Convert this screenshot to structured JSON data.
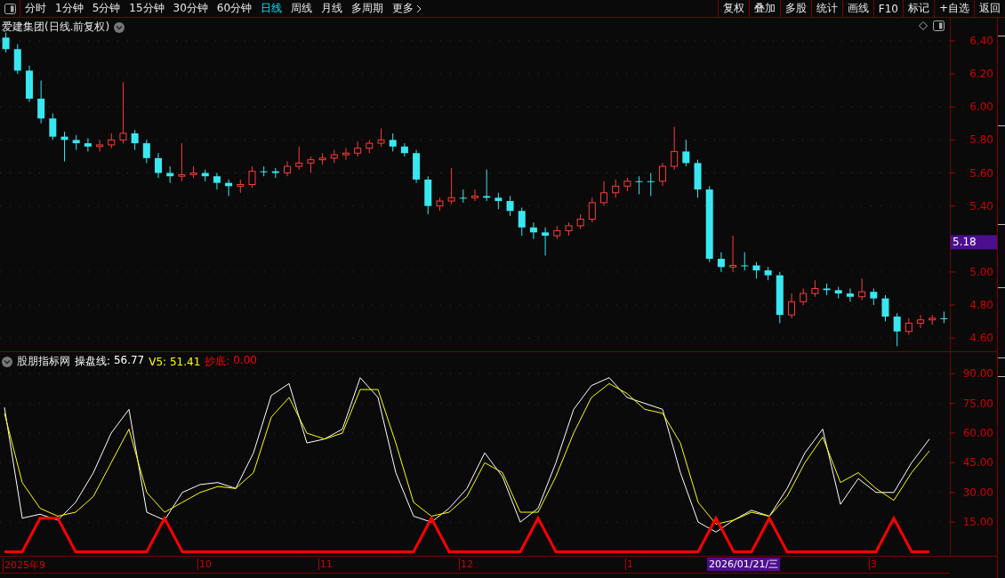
{
  "toolbar": {
    "periods": [
      {
        "label": "分时",
        "selected": false
      },
      {
        "label": "1分钟",
        "selected": false
      },
      {
        "label": "5分钟",
        "selected": false
      },
      {
        "label": "15分钟",
        "selected": false
      },
      {
        "label": "30分钟",
        "selected": false
      },
      {
        "label": "60分钟",
        "selected": false
      },
      {
        "label": "日线",
        "selected": true
      },
      {
        "label": "周线",
        "selected": false
      },
      {
        "label": "月线",
        "selected": false
      },
      {
        "label": "多周期",
        "selected": false
      },
      {
        "label": "更多",
        "selected": false
      }
    ],
    "buttons": [
      "复权",
      "叠加",
      "多股",
      "统计",
      "画线",
      "F10",
      "标记",
      "+自选",
      "返回"
    ]
  },
  "price_chart": {
    "title": "爱建集团(日线.前复权)",
    "last_price": "5.18",
    "chart_data": {
      "type": "candlestick",
      "grid": true,
      "ylim": [
        4.52,
        6.54
      ],
      "yticks": [
        {
          "value": 6.4,
          "label": "6.40"
        },
        {
          "value": 6.2,
          "label": "6.20"
        },
        {
          "value": 6.0,
          "label": "6.00"
        },
        {
          "value": 5.8,
          "label": "5.80"
        },
        {
          "value": 5.6,
          "label": "5.60"
        },
        {
          "value": 5.4,
          "label": "5.40"
        },
        {
          "value": 5.0,
          "label": "5.00"
        },
        {
          "value": 4.8,
          "label": "4.80"
        },
        {
          "value": 4.6,
          "label": "4.60"
        }
      ],
      "ohlc": [
        [
          6.42,
          6.45,
          6.33,
          6.35
        ],
        [
          6.35,
          6.38,
          6.2,
          6.22
        ],
        [
          6.22,
          6.25,
          6.03,
          6.05
        ],
        [
          6.05,
          6.16,
          5.9,
          5.93
        ],
        [
          5.93,
          5.96,
          5.8,
          5.82
        ],
        [
          5.82,
          5.85,
          5.67,
          5.8
        ],
        [
          5.8,
          5.83,
          5.74,
          5.78
        ],
        [
          5.78,
          5.81,
          5.73,
          5.76
        ],
        [
          5.76,
          5.8,
          5.73,
          5.77
        ],
        [
          5.77,
          5.84,
          5.75,
          5.8
        ],
        [
          5.8,
          6.15,
          5.78,
          5.84
        ],
        [
          5.84,
          5.86,
          5.74,
          5.78
        ],
        [
          5.78,
          5.8,
          5.66,
          5.69
        ],
        [
          5.69,
          5.72,
          5.57,
          5.6
        ],
        [
          5.6,
          5.64,
          5.54,
          5.58
        ],
        [
          5.58,
          5.78,
          5.55,
          5.59
        ],
        [
          5.59,
          5.64,
          5.57,
          5.6
        ],
        [
          5.6,
          5.62,
          5.55,
          5.58
        ],
        [
          5.58,
          5.6,
          5.5,
          5.54
        ],
        [
          5.54,
          5.56,
          5.46,
          5.52
        ],
        [
          5.52,
          5.56,
          5.48,
          5.53
        ],
        [
          5.53,
          5.64,
          5.51,
          5.61
        ],
        [
          5.61,
          5.64,
          5.58,
          5.61
        ],
        [
          5.61,
          5.63,
          5.57,
          5.6
        ],
        [
          5.6,
          5.67,
          5.58,
          5.64
        ],
        [
          5.64,
          5.76,
          5.62,
          5.66
        ],
        [
          5.66,
          5.7,
          5.6,
          5.68
        ],
        [
          5.68,
          5.72,
          5.65,
          5.69
        ],
        [
          5.69,
          5.74,
          5.66,
          5.71
        ],
        [
          5.71,
          5.75,
          5.68,
          5.72
        ],
        [
          5.72,
          5.79,
          5.7,
          5.75
        ],
        [
          5.75,
          5.8,
          5.72,
          5.78
        ],
        [
          5.78,
          5.87,
          5.76,
          5.8
        ],
        [
          5.8,
          5.84,
          5.73,
          5.76
        ],
        [
          5.76,
          5.78,
          5.7,
          5.72
        ],
        [
          5.72,
          5.74,
          5.54,
          5.56
        ],
        [
          5.56,
          5.58,
          5.35,
          5.4
        ],
        [
          5.4,
          5.45,
          5.37,
          5.43
        ],
        [
          5.43,
          5.63,
          5.41,
          5.45
        ],
        [
          5.45,
          5.5,
          5.42,
          5.45
        ],
        [
          5.45,
          5.5,
          5.43,
          5.46
        ],
        [
          5.46,
          5.62,
          5.43,
          5.45
        ],
        [
          5.45,
          5.48,
          5.38,
          5.43
        ],
        [
          5.43,
          5.46,
          5.34,
          5.37
        ],
        [
          5.37,
          5.39,
          5.22,
          5.27
        ],
        [
          5.27,
          5.3,
          5.2,
          5.24
        ],
        [
          5.24,
          5.27,
          5.1,
          5.22
        ],
        [
          5.22,
          5.28,
          5.2,
          5.25
        ],
        [
          5.25,
          5.3,
          5.22,
          5.28
        ],
        [
          5.28,
          5.35,
          5.26,
          5.32
        ],
        [
          5.32,
          5.45,
          5.3,
          5.42
        ],
        [
          5.42,
          5.55,
          5.4,
          5.48
        ],
        [
          5.48,
          5.56,
          5.45,
          5.52
        ],
        [
          5.52,
          5.57,
          5.49,
          5.55
        ],
        [
          5.55,
          5.58,
          5.47,
          5.55
        ],
        [
          5.55,
          5.6,
          5.46,
          5.55
        ],
        [
          5.55,
          5.66,
          5.52,
          5.64
        ],
        [
          5.64,
          5.88,
          5.62,
          5.73
        ],
        [
          5.73,
          5.8,
          5.64,
          5.66
        ],
        [
          5.66,
          5.68,
          5.45,
          5.5
        ],
        [
          5.5,
          5.52,
          5.06,
          5.08
        ],
        [
          5.08,
          5.12,
          5.0,
          5.03
        ],
        [
          5.03,
          5.22,
          5.0,
          5.04
        ],
        [
          5.04,
          5.12,
          5.01,
          5.04
        ],
        [
          5.04,
          5.06,
          4.96,
          5.01
        ],
        [
          5.01,
          5.03,
          4.95,
          4.98
        ],
        [
          4.98,
          5.0,
          4.69,
          4.74
        ],
        [
          4.74,
          4.87,
          4.72,
          4.82
        ],
        [
          4.82,
          4.9,
          4.8,
          4.87
        ],
        [
          4.87,
          4.95,
          4.85,
          4.9
        ],
        [
          4.9,
          4.93,
          4.86,
          4.89
        ],
        [
          4.89,
          4.91,
          4.84,
          4.87
        ],
        [
          4.87,
          4.9,
          4.82,
          4.85
        ],
        [
          4.85,
          4.96,
          4.83,
          4.88
        ],
        [
          4.88,
          4.9,
          4.8,
          4.84
        ],
        [
          4.84,
          4.86,
          4.7,
          4.73
        ],
        [
          4.73,
          4.75,
          4.55,
          4.64
        ],
        [
          4.64,
          4.72,
          4.62,
          4.69
        ],
        [
          4.69,
          4.74,
          4.66,
          4.71
        ],
        [
          4.71,
          4.74,
          4.68,
          4.72
        ],
        [
          4.72,
          4.76,
          4.69,
          4.72
        ]
      ]
    }
  },
  "indicator": {
    "name": "股朋指标网",
    "readings": [
      {
        "sep": ":",
        "value": "56.77"
      },
      {
        "sep": ":",
        "value": "51.41"
      },
      {
        "sep": ":",
        "value": "0.00"
      }
    ],
    "chart_data": {
      "type": "line",
      "grid": true,
      "ylim": [
        -2,
        100
      ],
      "yticks": [
        {
          "value": 90,
          "label": "90.00"
        },
        {
          "value": 75,
          "label": "75.00"
        },
        {
          "value": 60,
          "label": "60.00"
        },
        {
          "value": 45,
          "label": "45.00"
        },
        {
          "value": 30,
          "label": "30.00"
        },
        {
          "value": 15,
          "label": "15.00"
        }
      ],
      "series": [
        {
          "name": "操盘线",
          "color": "#ffffff",
          "values": [
            73,
            17,
            19,
            16,
            25,
            40,
            60,
            72,
            20,
            16,
            30,
            34,
            35,
            32,
            50,
            79,
            85,
            55,
            57,
            62,
            88,
            78,
            40,
            18,
            15,
            22,
            32,
            50,
            38,
            15,
            22,
            45,
            72,
            84,
            88,
            78,
            75,
            72,
            40,
            15,
            10,
            16,
            21,
            18,
            32,
            50,
            62,
            24,
            37,
            30,
            30,
            45,
            57
          ]
        },
        {
          "name": "V5",
          "color": "#ffff00",
          "values": [
            70,
            35,
            22,
            18,
            20,
            28,
            45,
            62,
            30,
            20,
            25,
            30,
            33,
            32,
            40,
            68,
            78,
            60,
            57,
            60,
            82,
            82,
            55,
            25,
            18,
            20,
            28,
            45,
            40,
            20,
            20,
            38,
            60,
            78,
            85,
            80,
            72,
            70,
            55,
            25,
            14,
            16,
            20,
            18,
            28,
            45,
            58,
            35,
            40,
            32,
            26,
            40,
            51
          ]
        },
        {
          "name": "抄底",
          "color": "#ff0000",
          "values": [
            0,
            0,
            17,
            17,
            0,
            0,
            0,
            0,
            0,
            17,
            0,
            0,
            0,
            0,
            0,
            0,
            0,
            0,
            0,
            0,
            0,
            0,
            0,
            0,
            17,
            0,
            0,
            0,
            0,
            0,
            17,
            0,
            0,
            0,
            0,
            0,
            0,
            0,
            0,
            0,
            17,
            0,
            0,
            17,
            0,
            0,
            0,
            0,
            0,
            0,
            17,
            0,
            0
          ]
        }
      ]
    }
  },
  "date_axis": {
    "labels": [
      "2025年9",
      "10",
      "11",
      "12",
      "1",
      "3"
    ],
    "cursor": "2026/01/21/三"
  }
}
